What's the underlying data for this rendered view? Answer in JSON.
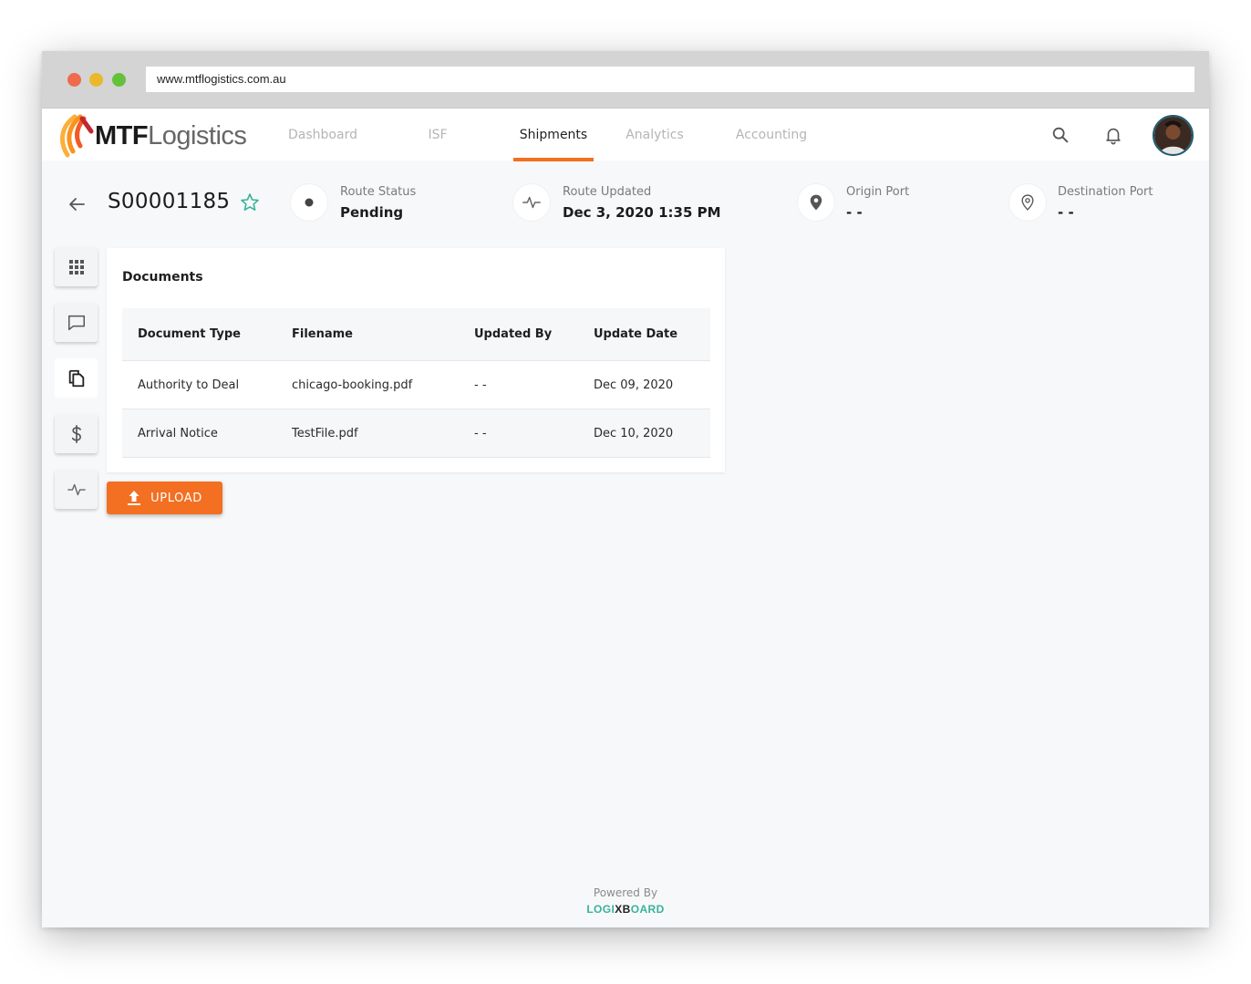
{
  "browser": {
    "url": "www.mtflogistics.com.au"
  },
  "brand": {
    "name_bold": "MTF",
    "name_light": "Logistics",
    "accent_color": "#f36f21"
  },
  "nav": {
    "items": [
      {
        "label": "Dashboard",
        "active": false
      },
      {
        "label": "ISF",
        "active": false
      },
      {
        "label": "Shipments",
        "active": true
      },
      {
        "label": "Analytics",
        "active": false
      },
      {
        "label": "Accounting",
        "active": false
      }
    ],
    "icons": [
      "search-icon",
      "bell-icon",
      "avatar"
    ]
  },
  "shipment": {
    "id": "S00001185",
    "stats": [
      {
        "icon": "dot-icon",
        "label": "Route Status",
        "value": "Pending"
      },
      {
        "icon": "activity-icon",
        "label": "Route Updated",
        "value": "Dec 3, 2020 1:35 PM"
      },
      {
        "icon": "map-pin-filled-icon",
        "label": "Origin Port",
        "value": "- -"
      },
      {
        "icon": "map-pin-outline-icon",
        "label": "Destination Port",
        "value": "- -"
      }
    ]
  },
  "sidebar": {
    "icons": [
      "grid-icon",
      "message-icon",
      "documents-icon",
      "dollar-icon",
      "activity-icon"
    ],
    "active": "documents-icon"
  },
  "documents": {
    "title": "Documents",
    "columns": [
      "Document Type",
      "Filename",
      "Updated By",
      "Update Date"
    ],
    "rows": [
      [
        "Authority to Deal",
        "chicago-booking.pdf",
        "- -",
        "Dec 09, 2020"
      ],
      [
        "Arrival Notice",
        "TestFile.pdf",
        "- -",
        "Dec 10, 2020"
      ]
    ],
    "upload_label": "UPLOAD"
  },
  "footer": {
    "powered_by": "Powered By",
    "brand_part1": "LOGI",
    "brand_part2": "XB",
    "brand_part3": "OARD"
  }
}
